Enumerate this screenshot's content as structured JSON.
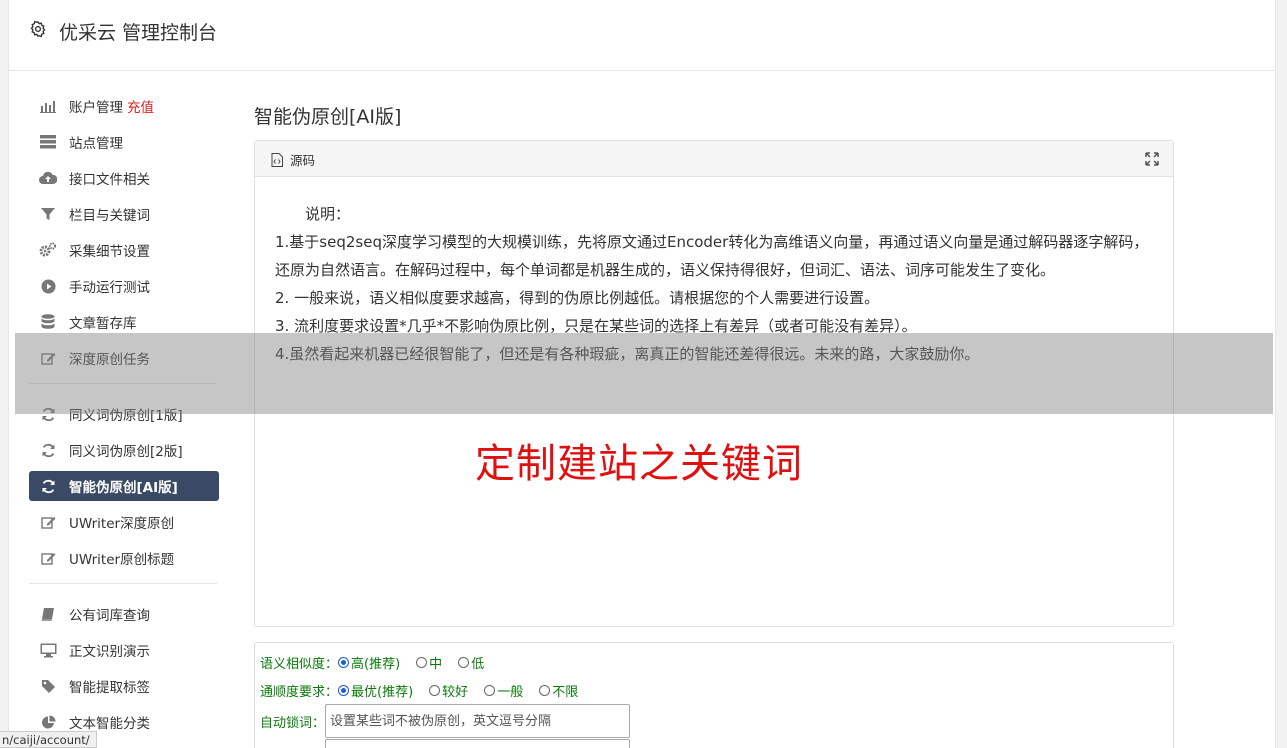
{
  "header": {
    "title": "优采云 管理控制台"
  },
  "sidebar": {
    "group1": [
      {
        "label": "账户管理",
        "extra": "充值",
        "icon": "bar-chart-icon"
      },
      {
        "label": "站点管理",
        "icon": "server-icon"
      },
      {
        "label": "接口文件相关",
        "icon": "cloud-upload-icon"
      },
      {
        "label": "栏目与关键词",
        "icon": "filter-icon"
      },
      {
        "label": "采集细节设置",
        "icon": "cogs-icon"
      },
      {
        "label": "手动运行测试",
        "icon": "play-circle-icon"
      },
      {
        "label": "文章暂存库",
        "icon": "database-icon"
      },
      {
        "label": "深度原创任务",
        "icon": "edit-icon"
      }
    ],
    "group2": [
      {
        "label": "同义词伪原创[1版]",
        "icon": "refresh-icon"
      },
      {
        "label": "同义词伪原创[2版]",
        "icon": "refresh-icon"
      },
      {
        "label": "智能伪原创[AI版]",
        "icon": "refresh-icon",
        "active": true
      },
      {
        "label": "UWriter深度原创",
        "icon": "edit-icon"
      },
      {
        "label": "UWriter原创标题",
        "icon": "edit-icon"
      }
    ],
    "group3": [
      {
        "label": "公有词库查询",
        "icon": "book-icon"
      },
      {
        "label": "正文识别演示",
        "icon": "desktop-icon"
      },
      {
        "label": "智能提取标签",
        "icon": "tag-icon"
      },
      {
        "label": "文本智能分类",
        "icon": "pie-chart-icon"
      }
    ]
  },
  "main": {
    "title": "智能伪原创[AI版]",
    "editor": {
      "source_label": "源码",
      "lines": [
        "　　说明：",
        "1.基于seq2seq深度学习模型的大规模训练，先将原文通过Encoder转化为高维语义向量，再通过语义向量是通过解码器逐字解码，还原为自然语言。在解码过程中，每个单词都是机器生成的，语义保持得很好，但词汇、语法、词序可能发生了变化。",
        "2. 一般来说，语义相似度要求越高，得到的伪原比例越低。请根据您的个人需要进行设置。",
        "3. 流利度要求设置*几乎*不影响伪原比例，只是在某些词的选择上有差异（或者可能没有差异）。",
        "4.虽然看起来机器已经很智能了，但还是有各种瑕疵，离真正的智能还差得很远。未来的路，大家鼓励你。"
      ],
      "watermark": "定制建站之关键词"
    },
    "form": {
      "similarity_label": "语义相似度：",
      "similarity_options": [
        "高(推荐)",
        "中",
        "低"
      ],
      "fluency_label": "通顺度要求：",
      "fluency_options": [
        "最优(推荐)",
        "较好",
        "一般",
        "不限"
      ],
      "lock_label": "自动锁词：",
      "lock_placeholder": "设置某些词不被伪原创，英文逗号分隔"
    }
  },
  "status_url": "n/caiji/account/",
  "colors": {
    "active_bg": "#3a4a66",
    "recharge": "#e02020",
    "form_label": "#0a7a0a",
    "watermark": "#e01010"
  }
}
